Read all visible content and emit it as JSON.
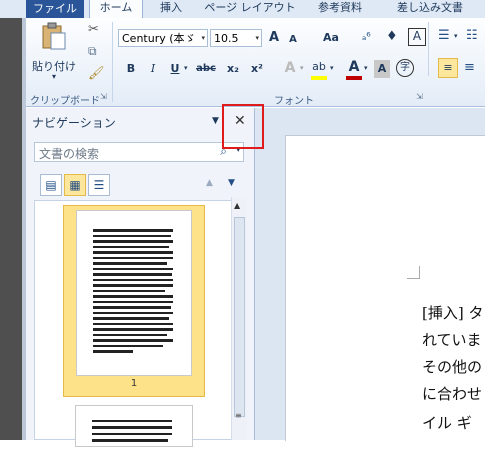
{
  "ribbon": {
    "tabs": [
      {
        "label": "ファイル"
      },
      {
        "label": "ホーム"
      },
      {
        "label": "挿入"
      },
      {
        "label": "ページ レイアウト"
      },
      {
        "label": "参考資料"
      },
      {
        "label": "差し込み文書"
      }
    ],
    "clipboard": {
      "paste_label": "貼り付け",
      "group_label": "クリップボード"
    },
    "font": {
      "font_name": "Century (本ゞ",
      "font_size": "10.5",
      "grow_label": "A",
      "shrink_label": "A",
      "case_label": "Aa",
      "group_label": "フォント",
      "bold": "B",
      "italic": "I",
      "underline": "U",
      "strike": "abc",
      "subscript": "x₂",
      "superscript": "x²",
      "clear_label": "A",
      "highlight_label": "ab",
      "fontcolor_label": "A",
      "shade_label": "A",
      "enclose_label": "字"
    },
    "colors": {
      "file_tab": "#2a5699",
      "highlight_red": "#e01b1b",
      "text_highlight": "#ffff00",
      "font_color": "#c00000"
    }
  },
  "nav": {
    "title": "ナビゲーション",
    "search_placeholder": "文書の検索",
    "page_number": "1"
  },
  "document": {
    "lines": [
      "[挿入] タ",
      "れていま",
      "その他の",
      "に合わせ",
      "イル ギ"
    ]
  }
}
